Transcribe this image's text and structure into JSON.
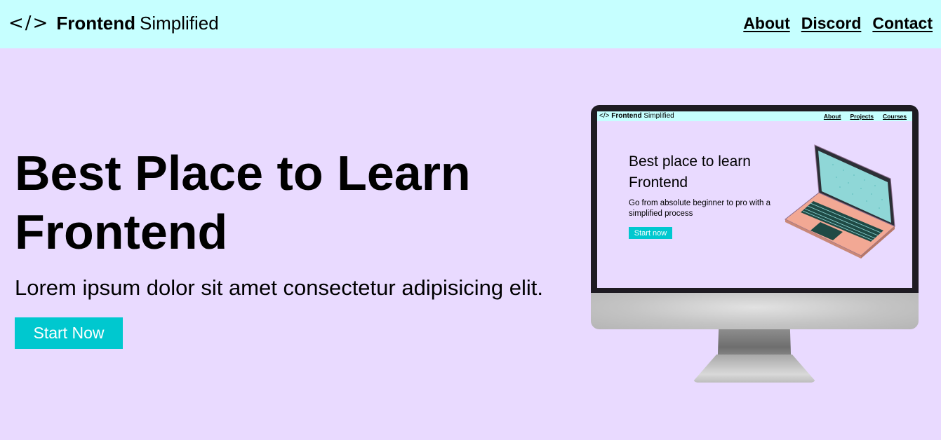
{
  "nav": {
    "logo_icon": "</>",
    "brand_bold": "Frontend",
    "brand_light": "Simplified",
    "links": [
      "About",
      "Discord",
      "Contact"
    ]
  },
  "hero": {
    "title": "Best Place to Learn Frontend",
    "subtitle": "Lorem ipsum dolor sit amet consectetur adipisicing elit.",
    "cta": "Start Now"
  },
  "monitor_screen": {
    "logo_icon": "</>",
    "brand_bold": "Frontend",
    "brand_light": "Simplified",
    "links": [
      "About",
      "Projects",
      "Courses"
    ],
    "title": "Best place to learn Frontend",
    "subtitle": "Go from absolute beginner to pro with a simplified process",
    "cta": "Start now"
  },
  "colors": {
    "nav_bg": "#c6ffff",
    "page_bg": "#e9daff",
    "accent": "#00c8cf",
    "text": "#000000"
  },
  "icons": [
    "code-brackets-icon",
    "laptop-icon",
    "monitor-icon"
  ]
}
